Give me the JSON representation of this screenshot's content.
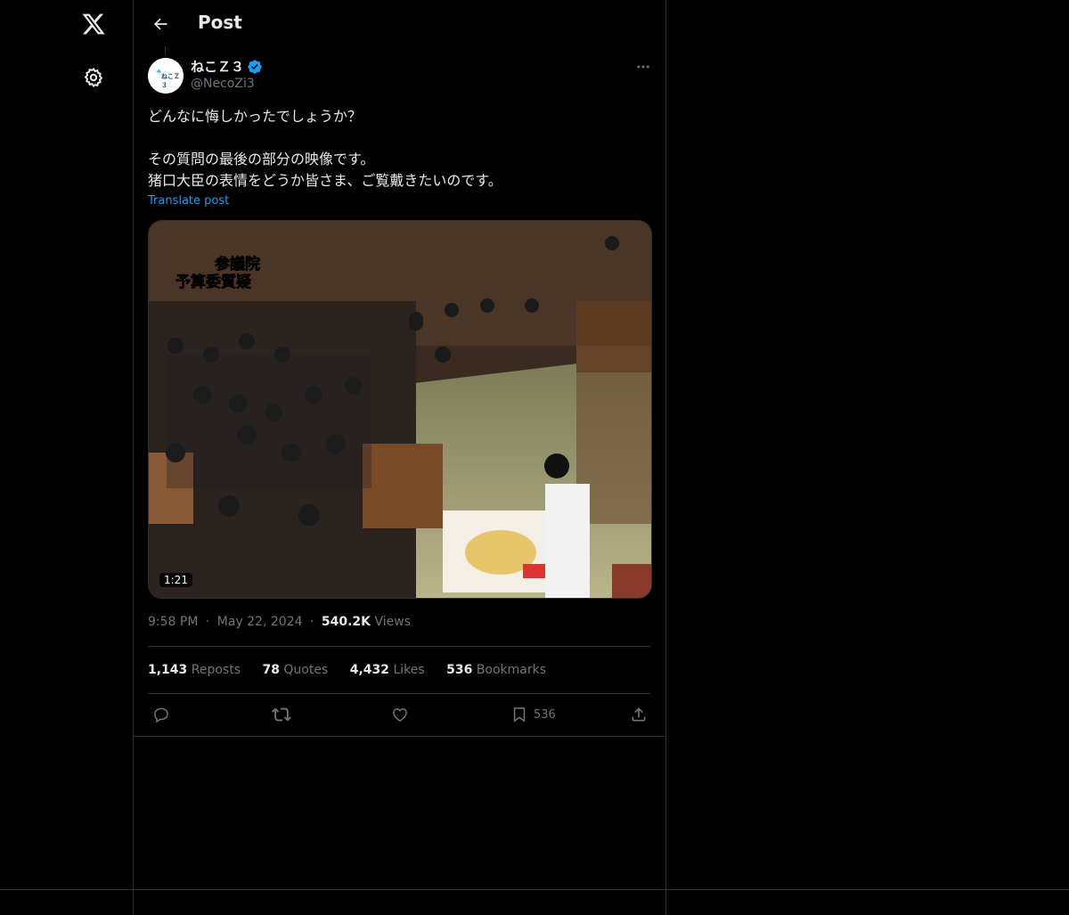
{
  "nav": {
    "logo_icon": "x-logo-icon",
    "settings_icon": "gear-icon"
  },
  "header": {
    "title": "Post"
  },
  "post": {
    "author_name": "ねこＺ３",
    "author_handle": "@NecoZi3",
    "avatar_text": "ねこＺ３",
    "verified": true,
    "text_lines": [
      "どんなに悔しかったでしょうか？",
      "",
      "その質問の最後の部分の映像です。",
      "猪口大臣の表情をどうか皆さま、ご覧戴きたいのです。"
    ],
    "translate_label": "Translate post",
    "media": {
      "duration": "1:21",
      "caption_line1": "参議院",
      "caption_line2": "予算委質疑"
    },
    "time": "9:58 PM",
    "date": "May 22, 2024",
    "views_count": "540.2K",
    "views_label": "Views",
    "stats": {
      "reposts_count": "1,143",
      "reposts_label": "Reposts",
      "quotes_count": "78",
      "quotes_label": "Quotes",
      "likes_count": "4,432",
      "likes_label": "Likes",
      "bookmarks_count": "536",
      "bookmarks_label": "Bookmarks"
    },
    "actions": {
      "bookmark_count": "536"
    }
  },
  "colors": {
    "background": "#000000",
    "text": "#e7e9ea",
    "muted": "#71767b",
    "accent": "#1d9bf0",
    "border": "#2f3336"
  }
}
